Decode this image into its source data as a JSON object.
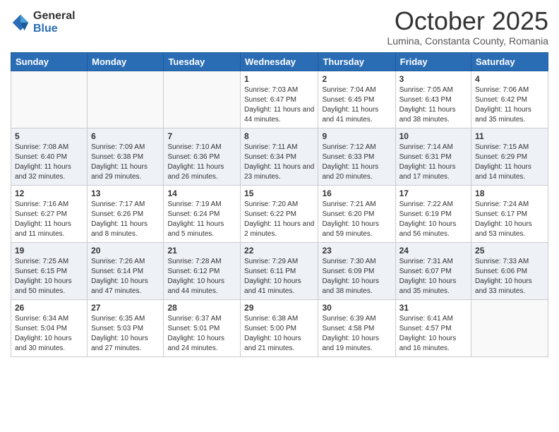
{
  "header": {
    "logo": {
      "general": "General",
      "blue": "Blue"
    },
    "title": "October 2025",
    "location": "Lumina, Constanta County, Romania"
  },
  "weekdays": [
    "Sunday",
    "Monday",
    "Tuesday",
    "Wednesday",
    "Thursday",
    "Friday",
    "Saturday"
  ],
  "weeks": [
    [
      {
        "day": "",
        "sunrise": "",
        "sunset": "",
        "daylight": ""
      },
      {
        "day": "",
        "sunrise": "",
        "sunset": "",
        "daylight": ""
      },
      {
        "day": "",
        "sunrise": "",
        "sunset": "",
        "daylight": ""
      },
      {
        "day": "1",
        "sunrise": "Sunrise: 7:03 AM",
        "sunset": "Sunset: 6:47 PM",
        "daylight": "Daylight: 11 hours and 44 minutes."
      },
      {
        "day": "2",
        "sunrise": "Sunrise: 7:04 AM",
        "sunset": "Sunset: 6:45 PM",
        "daylight": "Daylight: 11 hours and 41 minutes."
      },
      {
        "day": "3",
        "sunrise": "Sunrise: 7:05 AM",
        "sunset": "Sunset: 6:43 PM",
        "daylight": "Daylight: 11 hours and 38 minutes."
      },
      {
        "day": "4",
        "sunrise": "Sunrise: 7:06 AM",
        "sunset": "Sunset: 6:42 PM",
        "daylight": "Daylight: 11 hours and 35 minutes."
      }
    ],
    [
      {
        "day": "5",
        "sunrise": "Sunrise: 7:08 AM",
        "sunset": "Sunset: 6:40 PM",
        "daylight": "Daylight: 11 hours and 32 minutes."
      },
      {
        "day": "6",
        "sunrise": "Sunrise: 7:09 AM",
        "sunset": "Sunset: 6:38 PM",
        "daylight": "Daylight: 11 hours and 29 minutes."
      },
      {
        "day": "7",
        "sunrise": "Sunrise: 7:10 AM",
        "sunset": "Sunset: 6:36 PM",
        "daylight": "Daylight: 11 hours and 26 minutes."
      },
      {
        "day": "8",
        "sunrise": "Sunrise: 7:11 AM",
        "sunset": "Sunset: 6:34 PM",
        "daylight": "Daylight: 11 hours and 23 minutes."
      },
      {
        "day": "9",
        "sunrise": "Sunrise: 7:12 AM",
        "sunset": "Sunset: 6:33 PM",
        "daylight": "Daylight: 11 hours and 20 minutes."
      },
      {
        "day": "10",
        "sunrise": "Sunrise: 7:14 AM",
        "sunset": "Sunset: 6:31 PM",
        "daylight": "Daylight: 11 hours and 17 minutes."
      },
      {
        "day": "11",
        "sunrise": "Sunrise: 7:15 AM",
        "sunset": "Sunset: 6:29 PM",
        "daylight": "Daylight: 11 hours and 14 minutes."
      }
    ],
    [
      {
        "day": "12",
        "sunrise": "Sunrise: 7:16 AM",
        "sunset": "Sunset: 6:27 PM",
        "daylight": "Daylight: 11 hours and 11 minutes."
      },
      {
        "day": "13",
        "sunrise": "Sunrise: 7:17 AM",
        "sunset": "Sunset: 6:26 PM",
        "daylight": "Daylight: 11 hours and 8 minutes."
      },
      {
        "day": "14",
        "sunrise": "Sunrise: 7:19 AM",
        "sunset": "Sunset: 6:24 PM",
        "daylight": "Daylight: 11 hours and 5 minutes."
      },
      {
        "day": "15",
        "sunrise": "Sunrise: 7:20 AM",
        "sunset": "Sunset: 6:22 PM",
        "daylight": "Daylight: 11 hours and 2 minutes."
      },
      {
        "day": "16",
        "sunrise": "Sunrise: 7:21 AM",
        "sunset": "Sunset: 6:20 PM",
        "daylight": "Daylight: 10 hours and 59 minutes."
      },
      {
        "day": "17",
        "sunrise": "Sunrise: 7:22 AM",
        "sunset": "Sunset: 6:19 PM",
        "daylight": "Daylight: 10 hours and 56 minutes."
      },
      {
        "day": "18",
        "sunrise": "Sunrise: 7:24 AM",
        "sunset": "Sunset: 6:17 PM",
        "daylight": "Daylight: 10 hours and 53 minutes."
      }
    ],
    [
      {
        "day": "19",
        "sunrise": "Sunrise: 7:25 AM",
        "sunset": "Sunset: 6:15 PM",
        "daylight": "Daylight: 10 hours and 50 minutes."
      },
      {
        "day": "20",
        "sunrise": "Sunrise: 7:26 AM",
        "sunset": "Sunset: 6:14 PM",
        "daylight": "Daylight: 10 hours and 47 minutes."
      },
      {
        "day": "21",
        "sunrise": "Sunrise: 7:28 AM",
        "sunset": "Sunset: 6:12 PM",
        "daylight": "Daylight: 10 hours and 44 minutes."
      },
      {
        "day": "22",
        "sunrise": "Sunrise: 7:29 AM",
        "sunset": "Sunset: 6:11 PM",
        "daylight": "Daylight: 10 hours and 41 minutes."
      },
      {
        "day": "23",
        "sunrise": "Sunrise: 7:30 AM",
        "sunset": "Sunset: 6:09 PM",
        "daylight": "Daylight: 10 hours and 38 minutes."
      },
      {
        "day": "24",
        "sunrise": "Sunrise: 7:31 AM",
        "sunset": "Sunset: 6:07 PM",
        "daylight": "Daylight: 10 hours and 35 minutes."
      },
      {
        "day": "25",
        "sunrise": "Sunrise: 7:33 AM",
        "sunset": "Sunset: 6:06 PM",
        "daylight": "Daylight: 10 hours and 33 minutes."
      }
    ],
    [
      {
        "day": "26",
        "sunrise": "Sunrise: 6:34 AM",
        "sunset": "Sunset: 5:04 PM",
        "daylight": "Daylight: 10 hours and 30 minutes."
      },
      {
        "day": "27",
        "sunrise": "Sunrise: 6:35 AM",
        "sunset": "Sunset: 5:03 PM",
        "daylight": "Daylight: 10 hours and 27 minutes."
      },
      {
        "day": "28",
        "sunrise": "Sunrise: 6:37 AM",
        "sunset": "Sunset: 5:01 PM",
        "daylight": "Daylight: 10 hours and 24 minutes."
      },
      {
        "day": "29",
        "sunrise": "Sunrise: 6:38 AM",
        "sunset": "Sunset: 5:00 PM",
        "daylight": "Daylight: 10 hours and 21 minutes."
      },
      {
        "day": "30",
        "sunrise": "Sunrise: 6:39 AM",
        "sunset": "Sunset: 4:58 PM",
        "daylight": "Daylight: 10 hours and 19 minutes."
      },
      {
        "day": "31",
        "sunrise": "Sunrise: 6:41 AM",
        "sunset": "Sunset: 4:57 PM",
        "daylight": "Daylight: 10 hours and 16 minutes."
      },
      {
        "day": "",
        "sunrise": "",
        "sunset": "",
        "daylight": ""
      }
    ]
  ]
}
